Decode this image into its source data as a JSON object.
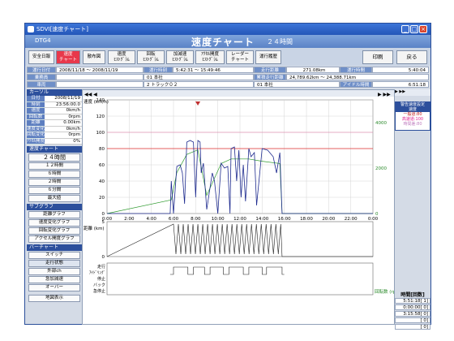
{
  "window": {
    "title": "SDVI[速度チャート]"
  },
  "header": {
    "code": "DTG4",
    "title": "速度チャート",
    "subtitle": "２４時間"
  },
  "toolbar": {
    "buttons": [
      "安全日報",
      "速度\nチャート",
      "散布図",
      "速度\nﾋｽﾄｸﾞﾗﾑ",
      "回転\nﾋｽﾄｸﾞﾗﾑ",
      "加減速\nﾋｽﾄｸﾞﾗﾑ",
      "ｱｸｾﾙ開度\nﾋｽﾄｸﾞﾗﾑ",
      "レーダー\nチャート",
      "運行履歴"
    ],
    "print": "印刷",
    "back": "戻る"
  },
  "info": {
    "r1": [
      "運行日付",
      "2008/11/18 〜 2008/11/19",
      "運行時刻",
      "5:42:31 〜 15:49:46",
      "走行距離",
      "271.08km",
      "運行時間",
      "5:40:04"
    ],
    "r2": [
      "乗務員",
      "",
      "01 本社",
      "",
      "累積走行距離",
      "24,789.62km 〜 24,388.71km"
    ],
    "r3": [
      "車両",
      "",
      "2 トラック０２",
      "",
      "01 本社",
      "",
      "アイドル時間",
      "6:51:18"
    ]
  },
  "cursor": {
    "title": "カーソル",
    "rows": [
      [
        "日付",
        "2008/11/19"
      ],
      [
        "時刻",
        "23:56:00.0"
      ],
      [
        "速度",
        "0km/h"
      ],
      [
        "回転数",
        "0rpm"
      ],
      [
        "距離",
        "0.00km"
      ],
      [
        "速度変化",
        "0km/h"
      ],
      [
        "回転変化",
        "0rpm"
      ],
      [
        "ｱｸｾﾙ開度",
        "0%"
      ]
    ]
  },
  "speed_chart_section": {
    "title": "速度チャート",
    "items": [
      "２４時間",
      "１２時間",
      "６時間",
      "２時間",
      "６分間",
      "最大値"
    ]
  },
  "sub_graph": {
    "title": "サブグラフ",
    "items": [
      "距離グラフ",
      "速度変化グラフ",
      "回転変化グラフ",
      "アクセル開度グラフ"
    ]
  },
  "bar_chart": {
    "title": "バーチャート",
    "items": [
      "スイッチ",
      "走行状態",
      "外部ch",
      "急加減速",
      "オーバー"
    ]
  },
  "map_button": "地図表示",
  "legend": {
    "header": "警告速度設定\n速度",
    "l1": "一般道:80",
    "l2": "高速道:100",
    "l3": "時間差:80"
  },
  "time_table": {
    "header": "時間[回数]",
    "rows": [
      "5:51:18[ 1]",
      "0:00:00[ 0]",
      "3:15:58[ 0]",
      "[ 0]",
      "[ 0]"
    ]
  },
  "chart_data": {
    "type": "line",
    "x_ticks": [
      "0:00",
      "2:00",
      "4:00",
      "6:00",
      "8:00",
      "10:00",
      "12:00",
      "14:00",
      "16:00",
      "18:00",
      "20:00",
      "22:00",
      "0:00"
    ],
    "speed_axis_label": "速度\n(km/h)",
    "speed_ticks": [
      0,
      20,
      40,
      60,
      80,
      100,
      120,
      140
    ],
    "rpm_axis_label": "回転数\n(rpm)",
    "rpm_ticks": [
      0,
      2000,
      4000
    ],
    "warning_line": 80,
    "warning_line2": 100,
    "distance_label": "距離\n(km)",
    "distance_ticks": [
      0,
      5
    ],
    "bar_labels": [
      "走行",
      "ｱｲﾄﾞﾘﾝｸﾞ",
      "停止",
      "バック",
      "急停止"
    ],
    "speed_series": [
      [
        0,
        0
      ],
      [
        5.7,
        0
      ],
      [
        5.8,
        40
      ],
      [
        6.0,
        0
      ],
      [
        6.3,
        58
      ],
      [
        6.6,
        60
      ],
      [
        6.8,
        50
      ],
      [
        7.0,
        12
      ],
      [
        7.2,
        88
      ],
      [
        7.5,
        90
      ],
      [
        7.8,
        88
      ],
      [
        8.0,
        20
      ],
      [
        8.2,
        90
      ],
      [
        8.4,
        88
      ],
      [
        8.5,
        50
      ],
      [
        8.7,
        62
      ],
      [
        9.0,
        5
      ],
      [
        9.5,
        50
      ],
      [
        9.7,
        40
      ],
      [
        10.0,
        0
      ],
      [
        10.3,
        62
      ],
      [
        10.6,
        56
      ],
      [
        10.9,
        58
      ],
      [
        11.1,
        0
      ],
      [
        11.2,
        80
      ],
      [
        11.5,
        82
      ],
      [
        11.7,
        40
      ],
      [
        11.9,
        78
      ],
      [
        12.1,
        20
      ],
      [
        12.3,
        60
      ],
      [
        12.5,
        15
      ],
      [
        12.8,
        80
      ],
      [
        13.0,
        70
      ],
      [
        13.3,
        75
      ],
      [
        13.5,
        10
      ],
      [
        14.0,
        80
      ],
      [
        14.5,
        78
      ],
      [
        15.0,
        70
      ],
      [
        15.3,
        50
      ],
      [
        15.6,
        75
      ],
      [
        15.8,
        0
      ],
      [
        24,
        0
      ]
    ],
    "rpm_series": [
      [
        0,
        0
      ],
      [
        5.8,
        600
      ],
      [
        6.3,
        1800
      ],
      [
        7.2,
        2600
      ],
      [
        8.2,
        2800
      ],
      [
        9.0,
        800
      ],
      [
        10.3,
        2200
      ],
      [
        11.2,
        2400
      ],
      [
        12.8,
        2400
      ],
      [
        14.0,
        2300
      ],
      [
        15.6,
        2200
      ],
      [
        15.8,
        0
      ],
      [
        24,
        0
      ]
    ]
  }
}
